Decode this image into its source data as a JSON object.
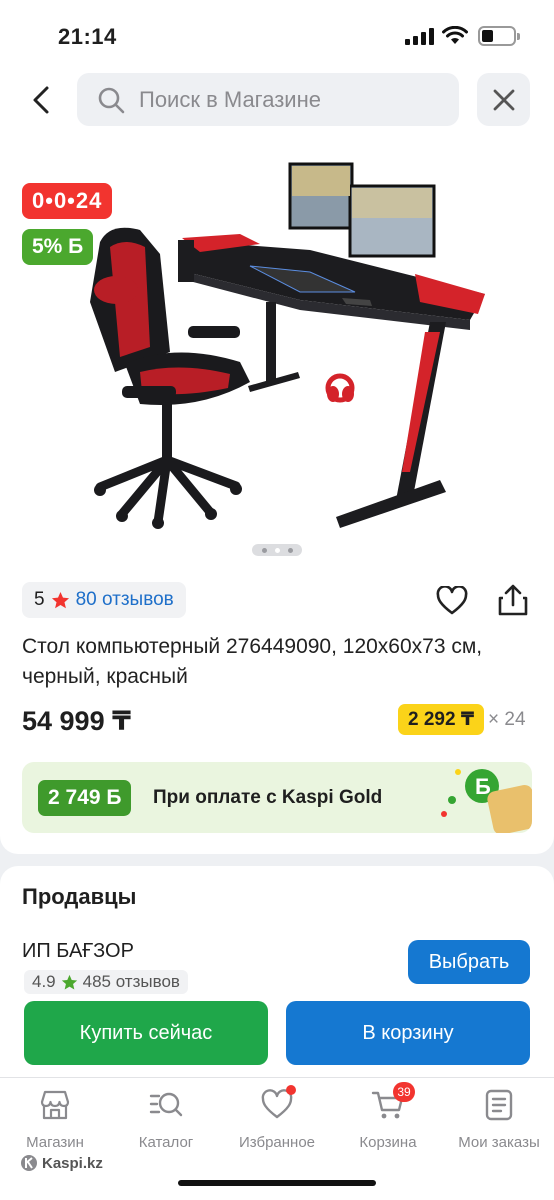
{
  "status_bar": {
    "time": "21:14"
  },
  "header": {
    "search_placeholder": "Поиск в Магазине"
  },
  "product": {
    "timer_badge": "0•0•24",
    "bonus_badge": "5% Б",
    "rating_value": "5",
    "reviews_label": "80 отзывов",
    "title": "Стол компьютерный 276449090, 120x60x73 см, черный, красный",
    "price": "54 999 ₸",
    "installment_amount": "2 292 ₸",
    "installment_months": "× 24",
    "kaspi_gold_bonus": "2 749 Б",
    "kaspi_gold_text": "При оплате с Kaspi Gold",
    "photo_count": 3,
    "photo_active_index": 1
  },
  "sellers": {
    "heading": "Продавцы",
    "name": "ИП БАҒЗОР",
    "rating_value": "4.9",
    "reviews_label": "485 отзывов",
    "choose_label": "Выбрать"
  },
  "actions": {
    "buy_now_label": "Купить сейчас",
    "add_to_cart_label": "В корзину"
  },
  "tabbar": {
    "items": [
      {
        "label": "Магазин",
        "icon": "store-icon"
      },
      {
        "label": "Каталог",
        "icon": "catalog-search-icon"
      },
      {
        "label": "Избранное",
        "icon": "heart-icon",
        "has_dot": true
      },
      {
        "label": "Корзина",
        "icon": "cart-icon",
        "badge": "39"
      },
      {
        "label": "Мои заказы",
        "icon": "orders-icon"
      }
    ]
  },
  "watermark": "Kaspi.kz",
  "colors": {
    "primary_blue": "#1578d1",
    "buy_green": "#1fa74a",
    "discount_red": "#f2342f",
    "bonus_green": "#4ba82e",
    "installment_yellow": "#fbd319"
  }
}
